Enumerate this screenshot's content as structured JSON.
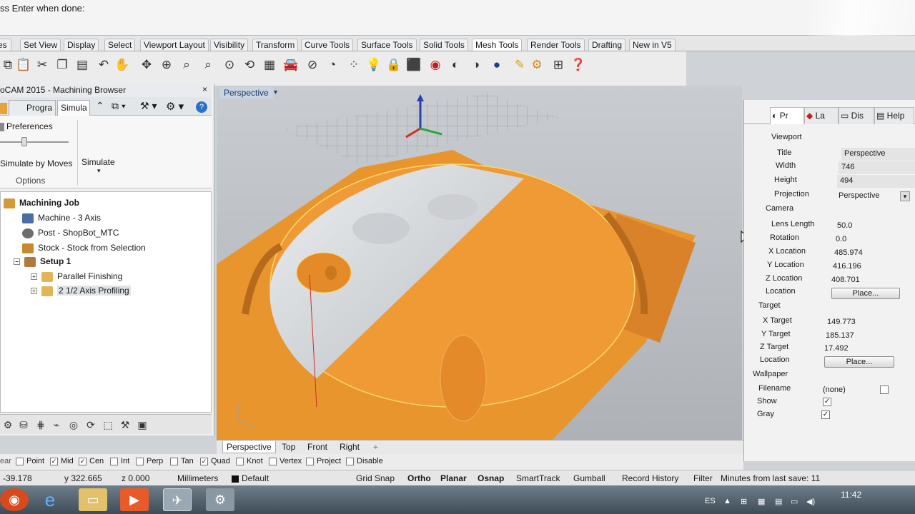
{
  "command_prompt": "ss Enter when done:",
  "menu_tabs": [
    "es",
    "Set View",
    "Display",
    "Select",
    "Viewport Layout",
    "Visibility",
    "Transform",
    "Curve Tools",
    "Surface Tools",
    "Solid Tools",
    "Mesh Tools",
    "Render Tools",
    "Drafting",
    "New in V5"
  ],
  "left_panel": {
    "title": "oCAM 2015 - Machining Browser",
    "close": "×",
    "tabs": [
      "Progra",
      "Simula"
    ],
    "preferences": "Preferences",
    "simulate_by_moves": "Simulate by Moves",
    "simulate": "Simulate",
    "options": "Options",
    "tree": {
      "job": "Machining Job",
      "machine": "Machine - 3 Axis",
      "post": "Post - ShopBot_MTC",
      "stock": "Stock - Stock from Selection",
      "setup": "Setup 1",
      "op1": "Parallel Finishing",
      "op2": "2 1/2 Axis Profiling"
    }
  },
  "viewport": {
    "label": "Perspective"
  },
  "view_tabs": [
    "Perspective",
    "Top",
    "Front",
    "Right",
    "⌖"
  ],
  "right_panel": {
    "tabs": [
      "Pr",
      "La",
      "Dis",
      "Help"
    ],
    "sections": {
      "viewport": "Viewport",
      "camera": "Camera",
      "target": "Target",
      "wallpaper": "Wallpaper"
    },
    "title_label": "Title",
    "title_value": "Perspective",
    "width_label": "Width",
    "width_value": "746",
    "height_label": "Height",
    "height_value": "494",
    "projection_label": "Projection",
    "projection_value": "Perspective",
    "lens_label": "Lens Length",
    "lens_value": "50.0",
    "rotation_label": "Rotation",
    "rotation_value": "0.0",
    "xloc_label": "X Location",
    "xloc_value": "485.974",
    "yloc_label": "Y Location",
    "yloc_value": "416.196",
    "zloc_label": "Z Location",
    "zloc_value": "408.701",
    "location_label": "Location",
    "place": "Place...",
    "xtarget_label": "X Target",
    "xtarget_value": "149.773",
    "ytarget_label": "Y Target",
    "ytarget_value": "185.137",
    "ztarget_label": "Z Target",
    "ztarget_value": "17.492",
    "tlocation_label": "Location",
    "tplace": "Place...",
    "filename_label": "Filename",
    "filename_value": "(none)",
    "show_label": "Show",
    "gray_label": "Gray"
  },
  "osnap": {
    "end": "Point",
    "mid": "Mid",
    "cen": "Cen",
    "int": "Int",
    "perp": "Perp",
    "tan": "Tan",
    "quad": "Quad",
    "knot": "Knot",
    "vertex": "Vertex",
    "project": "Project",
    "disable": "Disable",
    "left_cut": "ear"
  },
  "status": {
    "x": "-39.178",
    "y": "y 322.665",
    "z": "z 0.000",
    "units": "Millimeters",
    "layer": "Default",
    "grid_snap": "Grid Snap",
    "ortho": "Ortho",
    "planar": "Planar",
    "osnap": "Osnap",
    "smarttrack": "SmartTrack",
    "gumball": "Gumball",
    "record_history": "Record History",
    "filter": "Filter",
    "minutes": "Minutes from last save: 11"
  },
  "taskbar": {
    "lang": "ES",
    "time": "11:42"
  },
  "colors": {
    "stock": "#e8952e",
    "surface": "#d7d9dc",
    "accent": "#1e72c8"
  }
}
